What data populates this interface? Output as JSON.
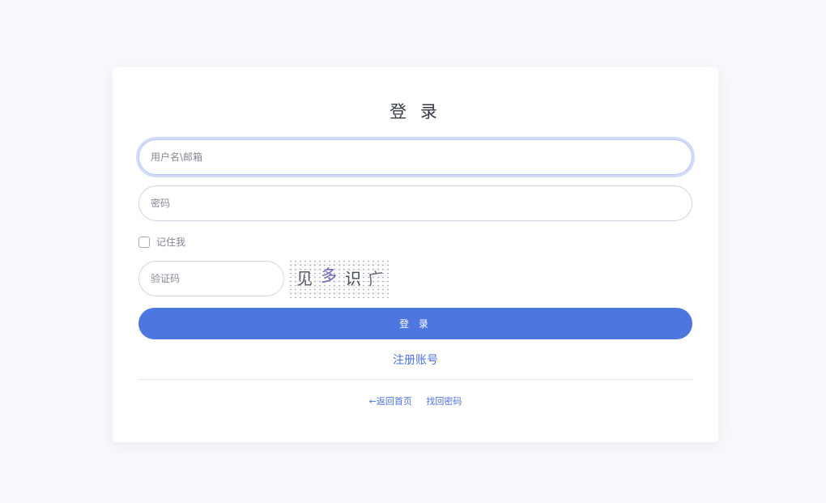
{
  "login_form": {
    "title": "登 录",
    "username_placeholder": "用户名\\邮箱",
    "password_placeholder": "密码",
    "remember_label": "记住我",
    "captcha_placeholder": "验证码",
    "captcha_chars": [
      "见",
      "多",
      "识",
      "广"
    ],
    "submit_label": "登 录",
    "register_link": "注册账号",
    "back_home_link": "←返回首页",
    "forgot_password_link": "找回密码"
  },
  "colors": {
    "accent": "#4e76df",
    "link": "#4e73df",
    "background": "#f8f9fc"
  }
}
